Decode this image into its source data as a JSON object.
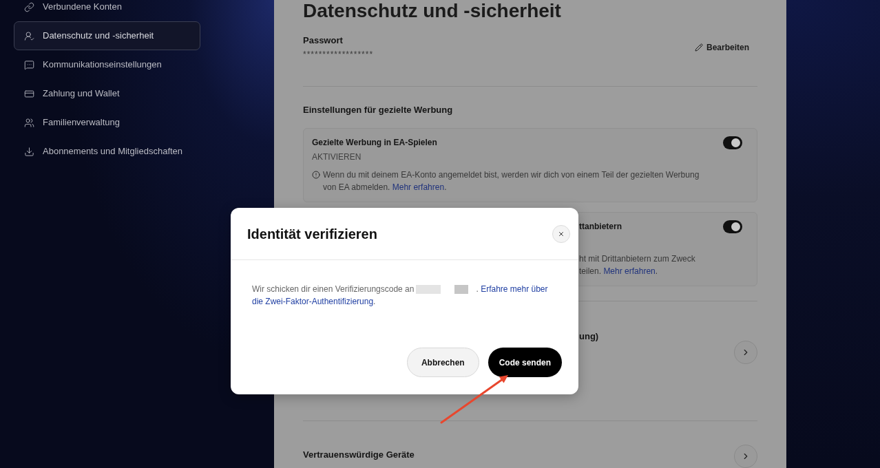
{
  "sidebar": {
    "items": [
      {
        "label": "Verbundene Konten",
        "selected": false
      },
      {
        "label": "Datenschutz und -sicherheit",
        "selected": true
      },
      {
        "label": "Kommunikationseinstellungen",
        "selected": false
      },
      {
        "label": "Zahlung und Wallet",
        "selected": false
      },
      {
        "label": "Familienverwaltung",
        "selected": false
      },
      {
        "label": "Abonnements und Mitgliedschaften",
        "selected": false
      }
    ]
  },
  "page": {
    "title": "Datenschutz und -sicherheit",
    "password": {
      "label": "Passwort",
      "value": "******************",
      "action": "Bearbeiten"
    },
    "targeted_ads": {
      "heading": "Einstellungen für gezielte Werbung",
      "items": [
        {
          "kind": "full",
          "title": "Gezielte Werbung in EA-Spielen",
          "status": "AKTIVIEREN",
          "on": true,
          "info": [
            {
              "kind": "text",
              "text": "Wenn du mit deinem EA-Konto angemeldet bist, werden wir dich von einem Teil der gezielten Werbung von EA abmelden."
            },
            {
              "kind": "link",
              "text": "Mehr erfahren"
            },
            {
              "kind": "text",
              "text": "."
            }
          ]
        },
        {
          "kind": "partial",
          "title": "ttanbietern",
          "on": true,
          "info_lines": [
            [
              {
                "kind": "text",
                "text": "ht mit Drittanbietern zum Zweck"
              }
            ],
            [
              {
                "kind": "text",
                "text": "teilen."
              },
              {
                "kind": "link",
                "text": "Mehr erfahren"
              },
              {
                "kind": "text",
                "text": "."
              }
            ]
          ]
        }
      ]
    },
    "sections": [
      {
        "kind": "partial",
        "title": "ung)"
      },
      {
        "kind": "full",
        "title": "Vertrauenswürdige Geräte"
      }
    ]
  },
  "dialog": {
    "title": "Identität verifizieren",
    "message": [
      {
        "kind": "text",
        "text": "Wir schicken dir einen Verifizierungscode an"
      },
      {
        "kind": "redacted"
      },
      {
        "kind": "redacted"
      },
      {
        "kind": "text",
        "text": "."
      },
      {
        "kind": "link",
        "text": "Erfahre mehr über"
      },
      {
        "kind": "link",
        "text": "die Zwei-Faktor-Authentifizierung"
      },
      {
        "kind": "text",
        "text": "."
      }
    ],
    "buttons": [
      {
        "kind": "secondary",
        "label": "Abbrechen"
      },
      {
        "kind": "primary",
        "label": "Code senden"
      }
    ]
  }
}
